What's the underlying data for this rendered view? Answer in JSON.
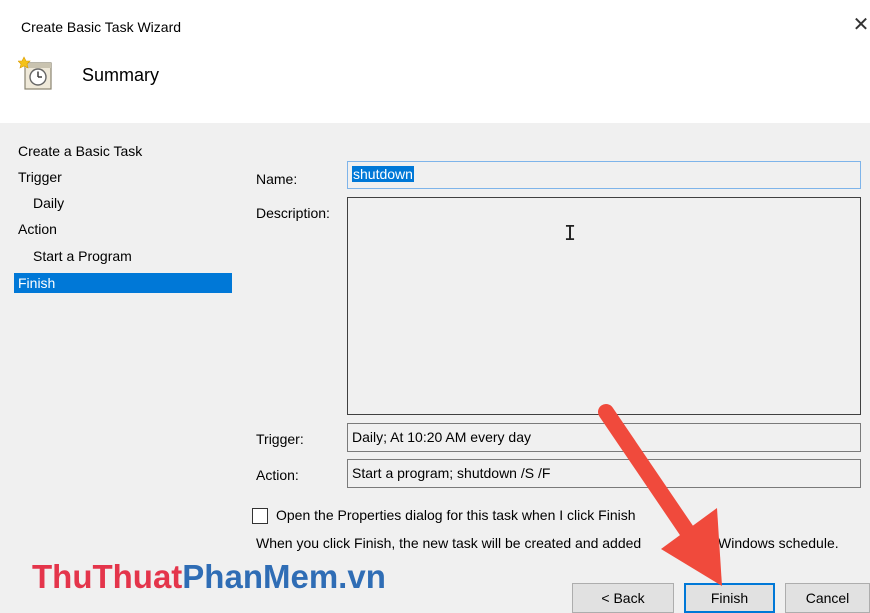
{
  "window": {
    "title": "Create Basic Task Wizard",
    "close_glyph": "✕"
  },
  "header": {
    "icon": "task-clock-icon",
    "title": "Summary"
  },
  "nav": {
    "items": [
      {
        "label": "Create a Basic Task",
        "level": 0,
        "selected": false
      },
      {
        "label": "Trigger",
        "level": 0,
        "selected": false
      },
      {
        "label": "Daily",
        "level": 1,
        "selected": false
      },
      {
        "label": "Action",
        "level": 0,
        "selected": false
      },
      {
        "label": "Start a Program",
        "level": 1,
        "selected": false
      },
      {
        "label": "Finish",
        "level": 0,
        "selected": true
      }
    ]
  },
  "form": {
    "name_label": "Name:",
    "name_value": "shutdown",
    "description_label": "Description:",
    "description_value": "",
    "trigger_label": "Trigger:",
    "trigger_value": "Daily; At 10:20 AM every day",
    "action_label": "Action:",
    "action_value": "Start a program; shutdown /S /F"
  },
  "options": {
    "open_properties_label": "Open the Properties dialog for this task when I click Finish",
    "open_properties_checked": false,
    "info_text": "When you click Finish, the new task will be created and added",
    "info_text_tail": "Windows schedule."
  },
  "buttons": {
    "back": "< Back",
    "finish": "Finish",
    "cancel": "Cancel"
  },
  "watermark": {
    "part1": "ThuThuat",
    "part2": "PhanMem",
    "part3": ".vn"
  },
  "colors": {
    "selection": "#0078d7",
    "annotation_arrow": "#f04a3c",
    "watermark_red": "#e4354b",
    "watermark_blue": "#2f6db5"
  }
}
